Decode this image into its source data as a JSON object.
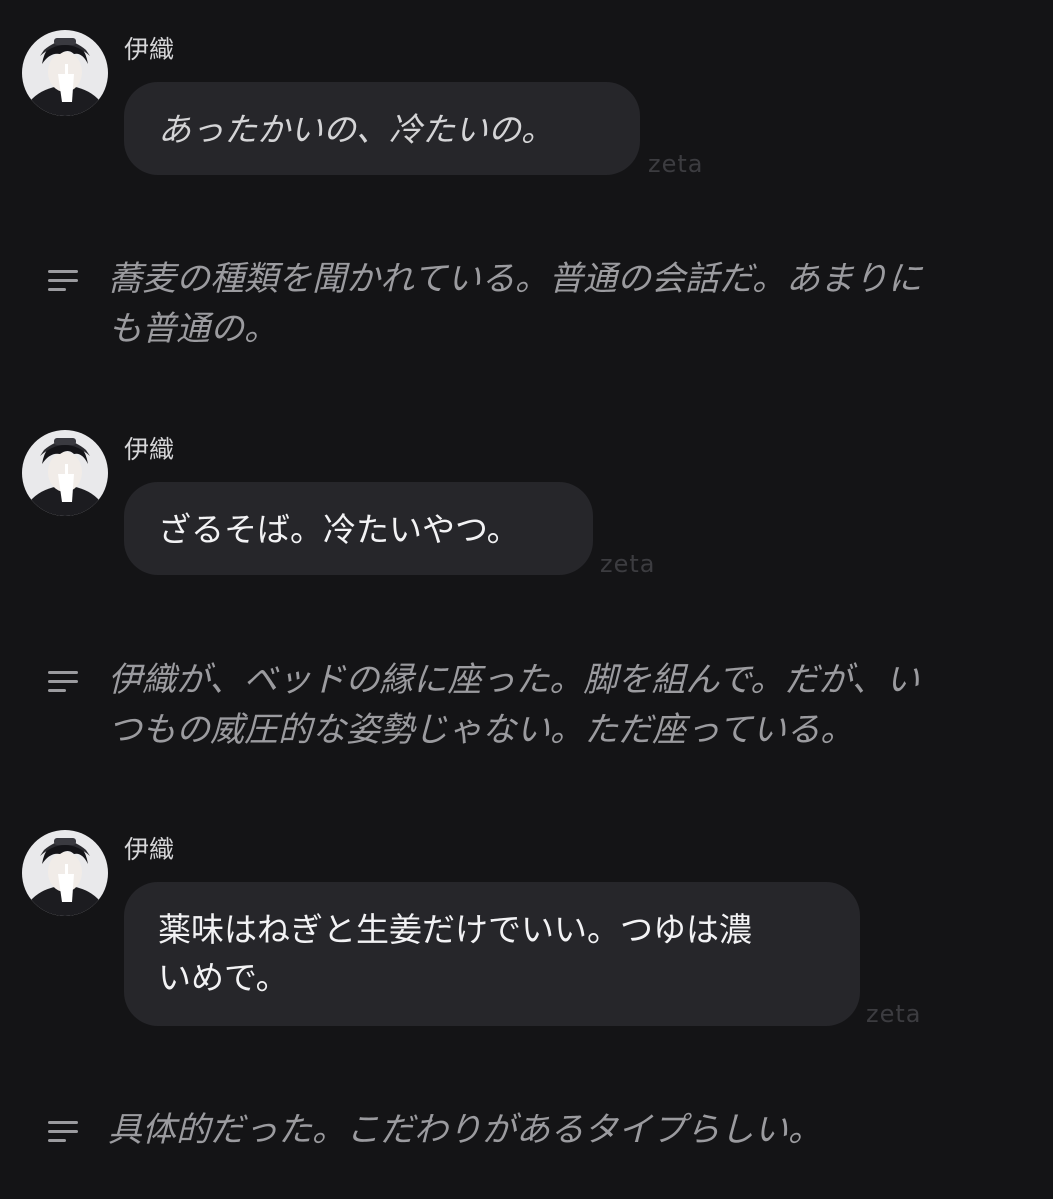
{
  "chat": {
    "messages": [
      {
        "author": "伊織",
        "text": "あったかいの、冷たいの。",
        "watermark": "zeta"
      },
      {
        "author": "伊織",
        "text": "ざるそば。冷たいやつ。",
        "watermark": "zeta"
      },
      {
        "author": "伊織",
        "text_line1": "薬味はねぎと生姜だけでいい。つゆは濃",
        "text_line2": "いめで。",
        "watermark": "zeta"
      }
    ],
    "narrations": [
      {
        "icon": "text-lines-icon",
        "line1": "蕎麦の種類を聞かれている。普通の会話だ。あまりに",
        "line2": "も普通の。"
      },
      {
        "icon": "text-lines-icon",
        "line1": "伊織が、ベッドの縁に座った。脚を組んで。だが、い",
        "line2": "つもの威圧的な姿勢じゃない。ただ座っている。"
      },
      {
        "icon": "text-lines-icon",
        "line1": "具体的だった。こだわりがあるタイプらしい。"
      }
    ]
  },
  "colors": {
    "background": "#141416",
    "bubble": "#26262a",
    "narration_text": "#9b9b9f",
    "watermark": "#3c3c40"
  }
}
